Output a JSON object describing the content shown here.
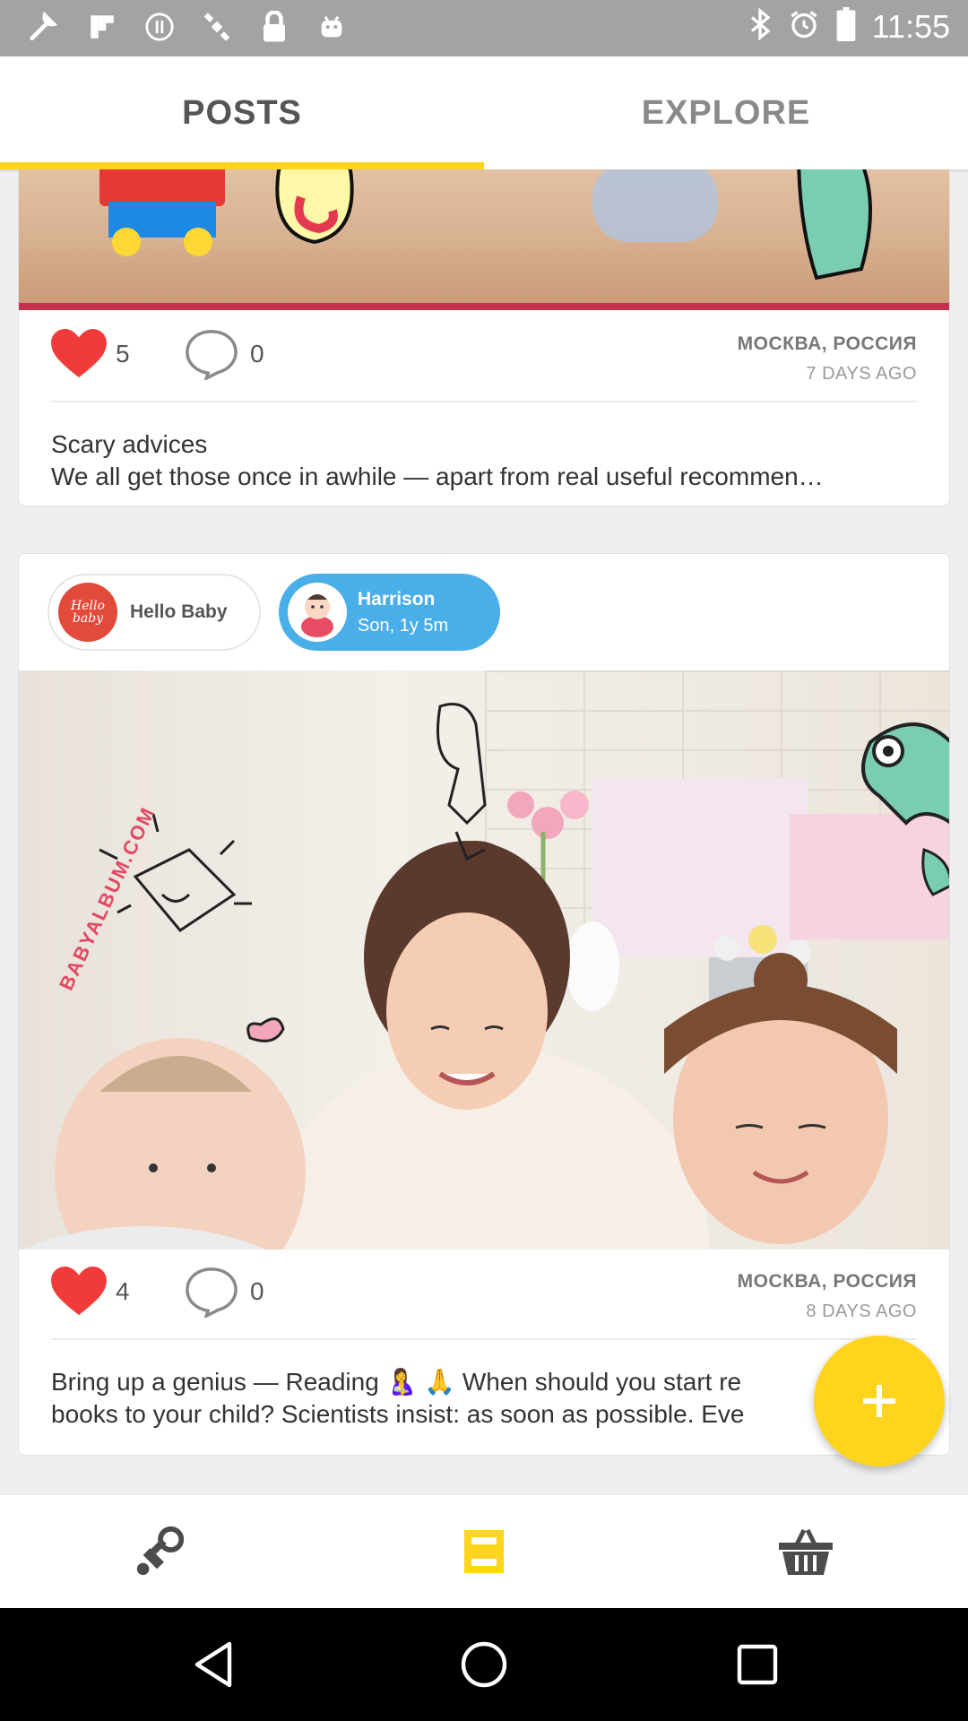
{
  "status_bar": {
    "time": "11:55",
    "icons": [
      "wrench-icon",
      "flipboard-icon",
      "pause-circle-icon",
      "satellite-icon",
      "lock-icon",
      "android-icon",
      "bluetooth-icon",
      "alarm-icon",
      "battery-icon"
    ]
  },
  "tabs": [
    {
      "label": "POSTS",
      "active": true
    },
    {
      "label": "EXPLORE",
      "active": false
    }
  ],
  "accent_color": "#ffd41d",
  "posts": [
    {
      "likes": "5",
      "comments": "0",
      "location": "МОСКВА, РОССИЯ",
      "ago": "7 DAYS AGO",
      "title": "Scary advices",
      "text": "We all get those once in awhile — apart from real useful recommen…"
    },
    {
      "brand": {
        "name": "Hello Baby",
        "logo_text": "Hello baby"
      },
      "child": {
        "name": "Harrison",
        "relation": "Son, 1y 5m"
      },
      "watermark": "BABYALBUM.COM",
      "likes": "4",
      "comments": "0",
      "location": "МОСКВА, РОССИЯ",
      "ago": "8 DAYS AGO",
      "text_line1": "Bring up a genius —  Reading 🤱 🙏 When should you start re",
      "text_line2": "books to your child? Scientists insist: as soon as possible. Eve"
    }
  ],
  "fab": {
    "icon": "plus-icon"
  },
  "bottom_nav": [
    {
      "icon": "pacifier-icon",
      "active": false
    },
    {
      "icon": "album-icon",
      "active": true
    },
    {
      "icon": "basket-icon",
      "active": false
    }
  ],
  "system_nav": [
    "back-icon",
    "home-icon",
    "recents-icon"
  ]
}
